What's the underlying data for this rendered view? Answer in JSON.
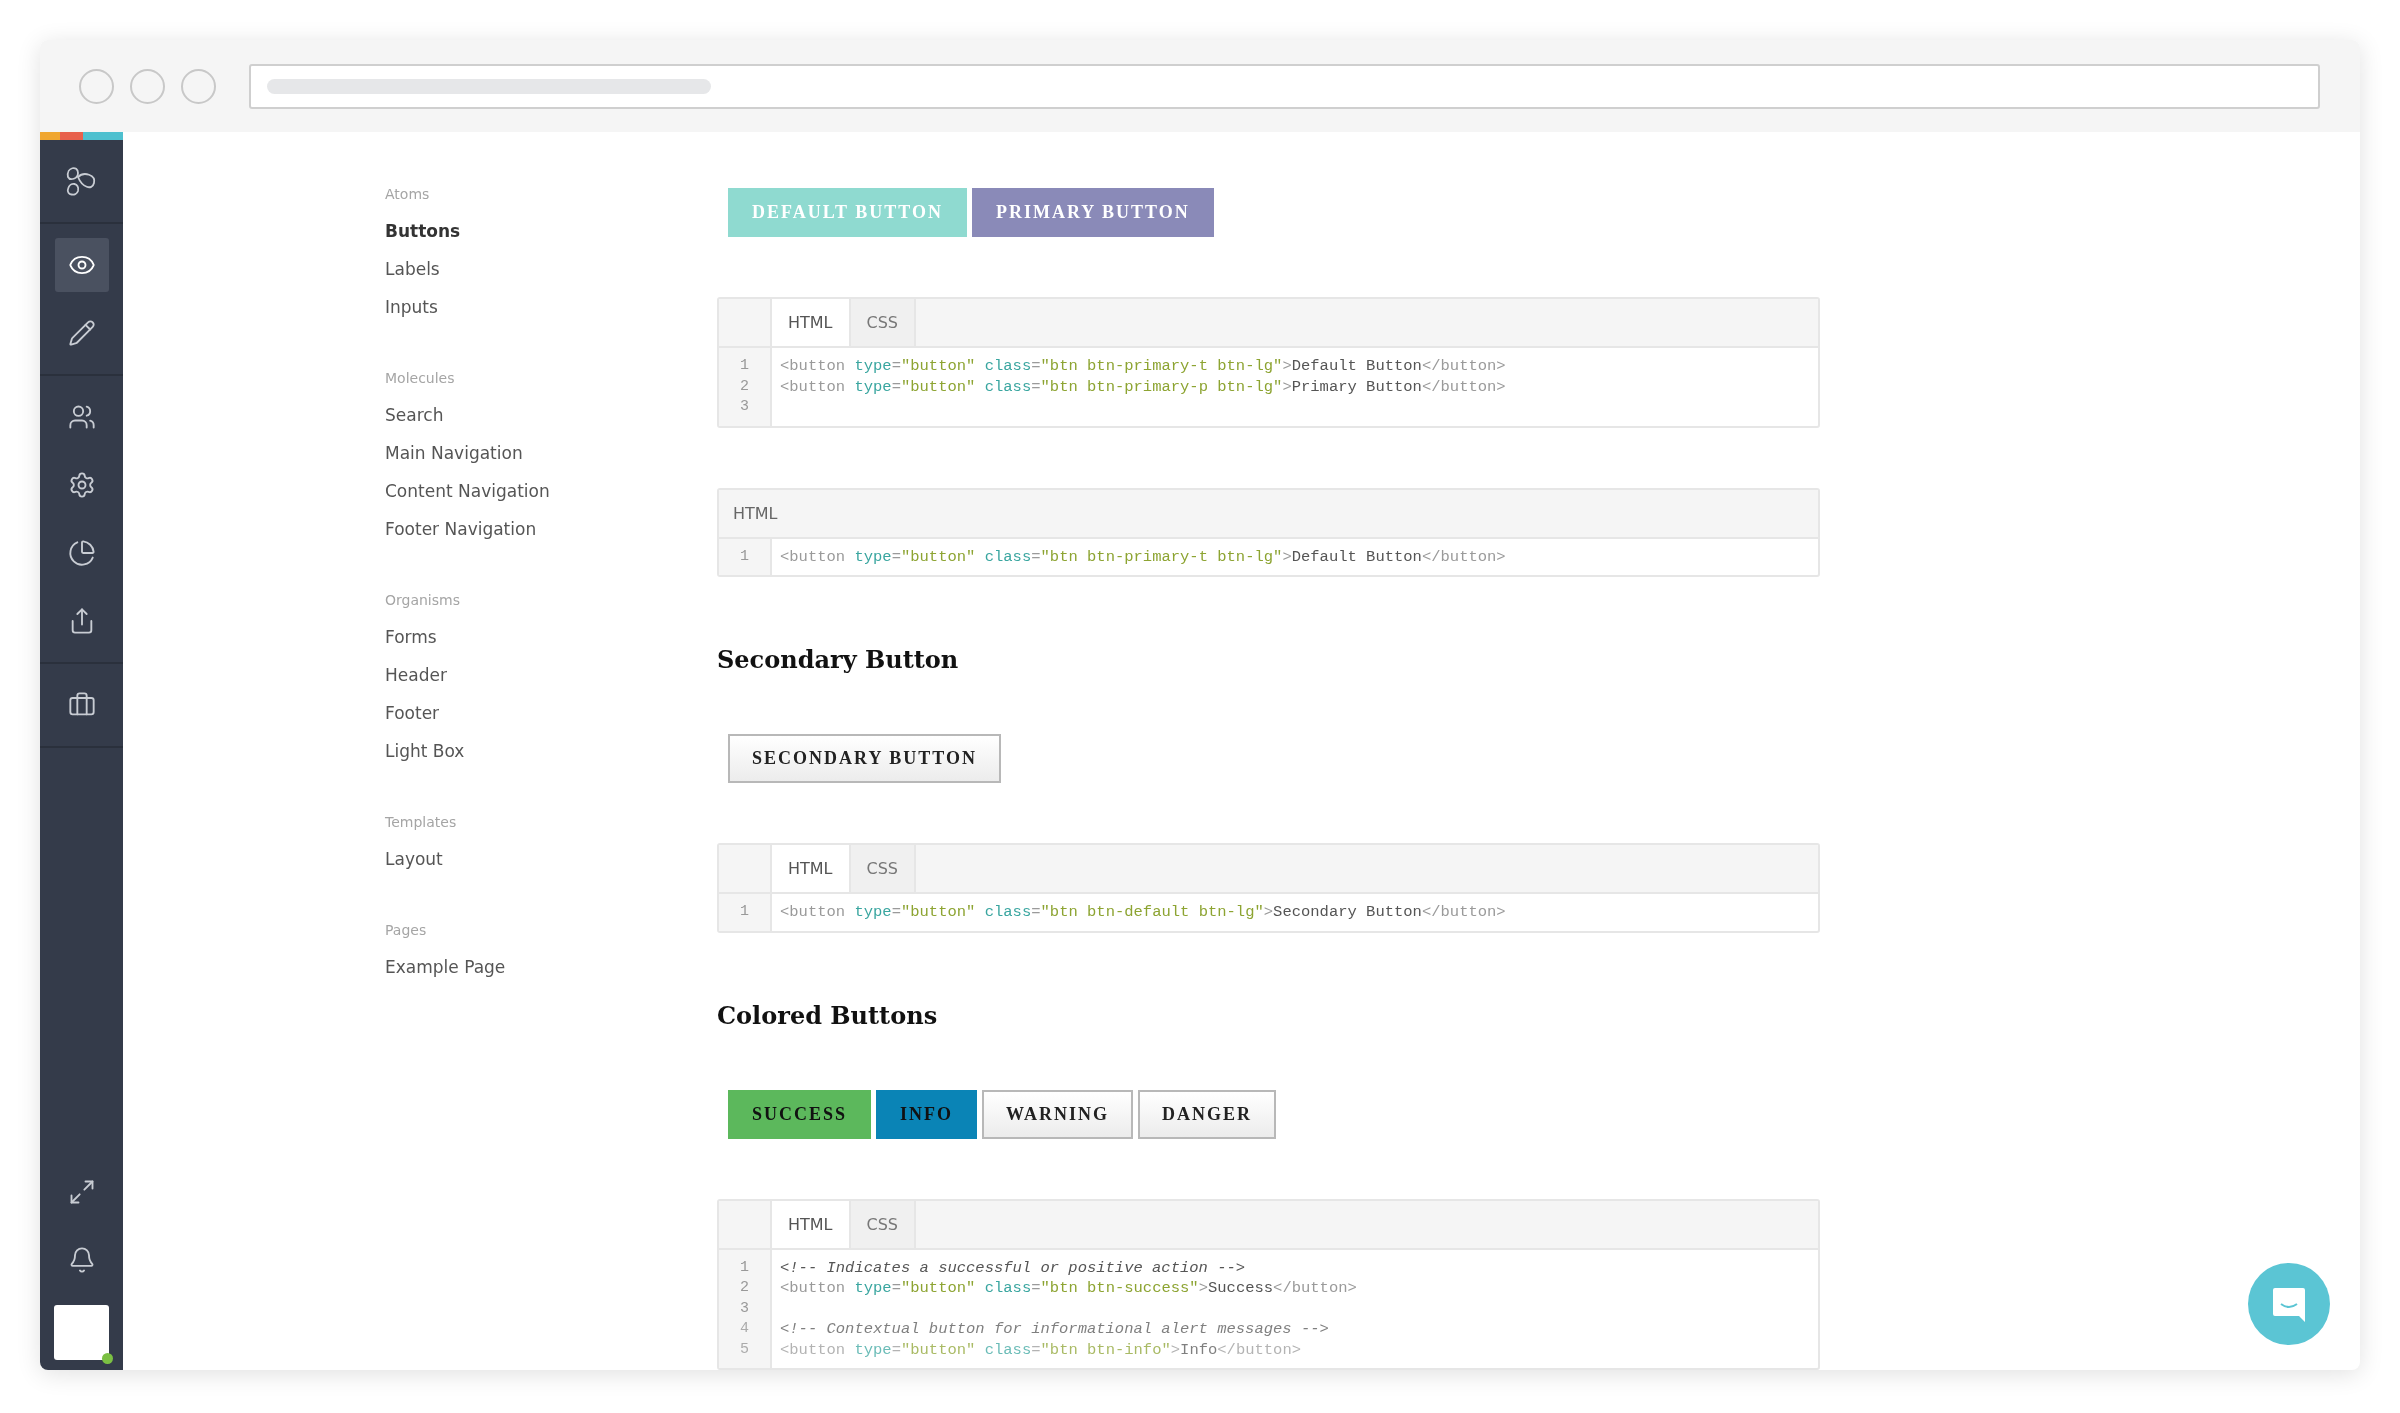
{
  "sidebar": {
    "items": [
      {
        "selected": false
      },
      {
        "selected": true
      },
      {
        "selected": false
      },
      {
        "selected": false
      },
      {
        "selected": false
      },
      {
        "selected": false
      },
      {
        "selected": false
      },
      {
        "selected": false
      }
    ],
    "user": {
      "online": true
    }
  },
  "nav": {
    "groups": [
      {
        "title": "Atoms",
        "items": [
          {
            "label": "Buttons",
            "selected": true
          },
          {
            "label": "Labels",
            "selected": false
          },
          {
            "label": "Inputs",
            "selected": false
          }
        ]
      },
      {
        "title": "Molecules",
        "items": [
          {
            "label": "Search",
            "selected": false
          },
          {
            "label": "Main Navigation",
            "selected": false
          },
          {
            "label": "Content Navigation",
            "selected": false
          },
          {
            "label": "Footer Navigation",
            "selected": false
          }
        ]
      },
      {
        "title": "Organisms",
        "items": [
          {
            "label": "Forms",
            "selected": false
          },
          {
            "label": "Header",
            "selected": false
          },
          {
            "label": "Footer",
            "selected": false
          },
          {
            "label": "Light Box",
            "selected": false
          }
        ]
      },
      {
        "title": "Templates",
        "items": [
          {
            "label": "Layout",
            "selected": false
          }
        ]
      },
      {
        "title": "Pages",
        "items": [
          {
            "label": "Example Page",
            "selected": false
          }
        ]
      }
    ]
  },
  "sections": [
    {
      "buttons": [
        {
          "label": "DEFAULT BUTTON",
          "kind": "teal"
        },
        {
          "label": "PRIMARY BUTTON",
          "kind": "purple"
        }
      ],
      "code_blocks": [
        {
          "kind": "tabbed",
          "tabs": [
            {
              "label": "HTML",
              "selected": true
            },
            {
              "label": "CSS",
              "selected": false
            }
          ],
          "lines": [
            {
              "number": "1",
              "kind": "code",
              "text": "<button type=\"button\" class=\"btn btn-primary-t btn-lg\">Default Button</button>"
            },
            {
              "number": "2",
              "kind": "code",
              "text": "<button type=\"button\" class=\"btn btn-primary-p btn-lg\">Primary Button</button>"
            },
            {
              "number": "3"
            }
          ]
        },
        {
          "kind": "titled",
          "title": "HTML",
          "lines": [
            {
              "number": "1",
              "kind": "code",
              "text": "<button type=\"button\" class=\"btn btn-primary-t btn-lg\">Default Button</button>"
            }
          ]
        }
      ]
    },
    {
      "heading": "Secondary Button",
      "buttons": [
        {
          "label": "SECONDARY BUTTON",
          "kind": "plain"
        }
      ],
      "code_blocks": [
        {
          "kind": "tabbed",
          "tabs": [
            {
              "label": "HTML",
              "selected": true
            },
            {
              "label": "CSS",
              "selected": false
            }
          ],
          "lines": [
            {
              "number": "1",
              "kind": "code",
              "text": "<button type=\"button\" class=\"btn btn-default btn-lg\">Secondary Button</button>"
            }
          ]
        }
      ]
    },
    {
      "heading": "Colored Buttons",
      "buttons": [
        {
          "label": "SUCCESS",
          "kind": "success"
        },
        {
          "label": "INFO",
          "kind": "info"
        },
        {
          "label": "WARNING",
          "kind": "plain"
        },
        {
          "label": "DANGER",
          "kind": "plain"
        }
      ],
      "code_blocks": [
        {
          "kind": "tabbed",
          "tabs": [
            {
              "label": "HTML",
              "selected": true
            },
            {
              "label": "CSS",
              "selected": false
            }
          ],
          "lines": [
            {
              "number": "1",
              "kind": "comment",
              "text": "<!-- Indicates a successful or positive action -->",
              "faded": false
            },
            {
              "number": "2",
              "kind": "code",
              "text": "<button type=\"button\" class=\"btn btn-success\">Success</button>",
              "faded": false
            },
            {
              "number": "3",
              "faded": false
            },
            {
              "number": "4",
              "kind": "comment",
              "text": "<!-- Contextual button for informational alert messages -->",
              "faded": true
            },
            {
              "number": "5",
              "kind": "code",
              "text": "<button type=\"button\" class=\"btn btn-info\">Info</button>",
              "faded": true
            }
          ]
        }
      ]
    }
  ]
}
